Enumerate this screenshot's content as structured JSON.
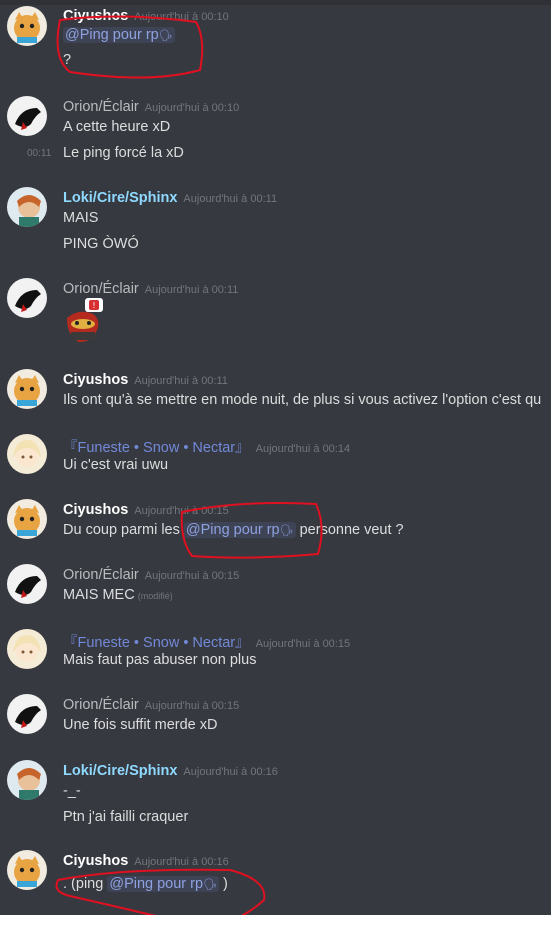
{
  "messages": [
    {
      "author": "Ciyushos",
      "timestamp": "Aujourd'hui à 00:10",
      "lines": [
        "?"
      ],
      "mention": "@Ping pour rp"
    },
    {
      "author": "Orion/Éclair",
      "timestamp": "Aujourd'hui à 00:10",
      "lines": [
        "A cette heure xD",
        "Le ping forcé la xD"
      ],
      "hover_time": "00:11"
    },
    {
      "author": "Loki/Cire/Sphinx",
      "timestamp": "Aujourd'hui à 00:11",
      "lines": [
        "MAIS",
        "PING ÒWÓ"
      ]
    },
    {
      "author": "Orion/Éclair",
      "timestamp": "Aujourd'hui à 00:11",
      "sticker_badge": "!"
    },
    {
      "author": "Ciyushos",
      "timestamp": "Aujourd'hui à 00:11",
      "lines": [
        "Ils ont qu'à se mettre en mode nuit, de plus si vous activez l'option c'est qu"
      ]
    },
    {
      "author": "『Funeste • Snow • Nectar』",
      "timestamp": "Aujourd'hui à 00:14",
      "lines": [
        "Ui c'est vrai uwu"
      ]
    },
    {
      "author": "Ciyushos",
      "timestamp": "Aujourd'hui à 00:15",
      "pre": "Du coup parmi les ",
      "mention": "@Ping pour rp",
      "post": " personne veut ?"
    },
    {
      "author": "Orion/Éclair",
      "timestamp": "Aujourd'hui à 00:15",
      "lines": [
        "MAIS MEC"
      ],
      "edited": "(modifié)"
    },
    {
      "author": "『Funeste • Snow • Nectar』",
      "timestamp": "Aujourd'hui à 00:15",
      "lines": [
        "Mais faut pas abuser non plus"
      ]
    },
    {
      "author": "Orion/Éclair",
      "timestamp": "Aujourd'hui à 00:15",
      "lines": [
        "Une fois suffit merde xD"
      ]
    },
    {
      "author": "Loki/Cire/Sphinx",
      "timestamp": "Aujourd'hui à 00:16",
      "lines": [
        "-_-",
        "Ptn j'ai failli craquer"
      ]
    },
    {
      "author": "Ciyushos",
      "timestamp": "Aujourd'hui à 00:16",
      "pre": ". (ping ",
      "mention": "@Ping pour rp",
      "post": " )"
    }
  ],
  "colors": {
    "background": "#36393f",
    "mention": "#8ea1e1",
    "annotation": "#e01020"
  },
  "icons": {
    "mention_glyph": "speaking-head-icon"
  }
}
